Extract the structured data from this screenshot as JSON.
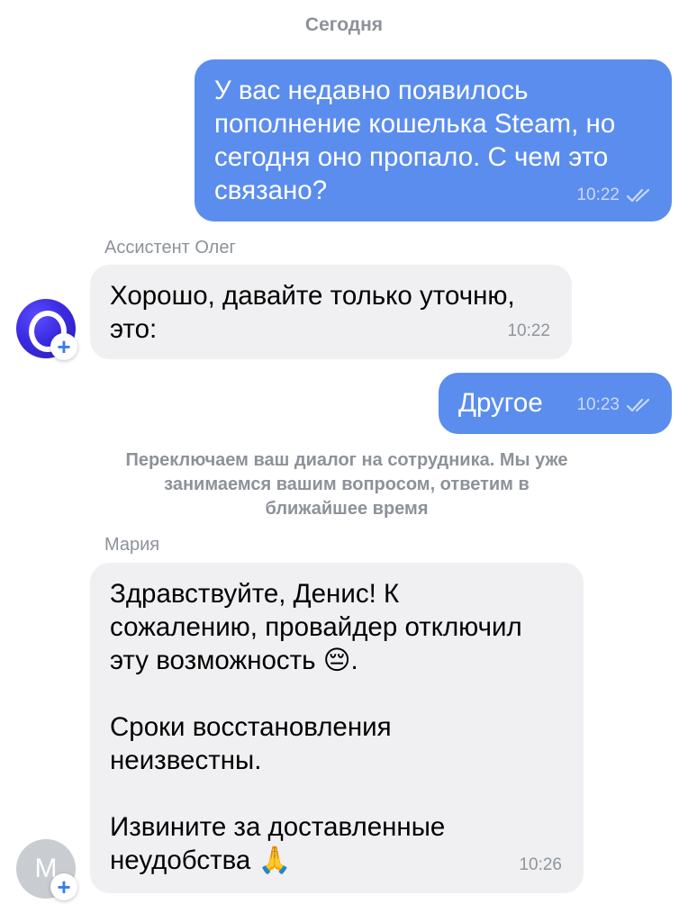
{
  "date_separator": "Сегодня",
  "messages": [
    {
      "text": "У вас недавно появилось\nпополнение кошелька Steam, но\nсегодня оно пропало. С чем это\nсвязано?",
      "time": "10:22"
    },
    {
      "sender": "Ассистент Олег",
      "text": "Хорошо, давайте только уточню,\nэто:",
      "time": "10:22"
    },
    {
      "text": "Другое",
      "time": "10:23"
    },
    {
      "sender": "Мария",
      "text": "Здравствуйте, Денис! К\nсожалению, провайдер отключил\nэту возможность 😔.\n\nСроки восстановления\nнеизвестны.\n\nИзвините за доставленные\nнеудобства 🙏",
      "time": "10:26"
    }
  ],
  "system_note": "Переключаем ваш диалог на сотрудника. Мы уже\nзанимаемся вашим вопросом, ответим в\nближайшее время",
  "avatars": {
    "oleg": {
      "icon": "assistant-logo-icon",
      "badge": "+"
    },
    "maria": {
      "initial": "М",
      "badge": "+"
    }
  },
  "colors": {
    "outgoing_bubble": "#5b8def",
    "incoming_bubble": "#f0f0f2",
    "secondary_text": "#8d9299",
    "accent": "#3c7bf0"
  }
}
